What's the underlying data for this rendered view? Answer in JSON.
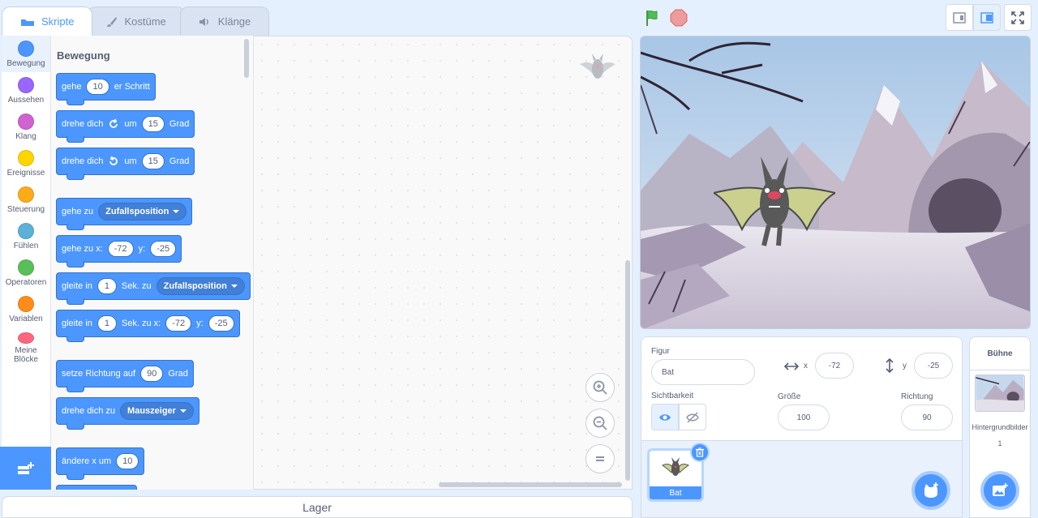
{
  "tabs": {
    "code": "Skripte",
    "costumes": "Kostüme",
    "sounds": "Klänge"
  },
  "categories": [
    {
      "label": "Bewegung",
      "color": "#4c97ff"
    },
    {
      "label": "Aussehen",
      "color": "#9966ff"
    },
    {
      "label": "Klang",
      "color": "#cf63cf"
    },
    {
      "label": "Ereignisse",
      "color": "#ffd500"
    },
    {
      "label": "Steuerung",
      "color": "#ffab19"
    },
    {
      "label": "Fühlen",
      "color": "#5cb1d6"
    },
    {
      "label": "Operatoren",
      "color": "#59c059"
    },
    {
      "label": "Variablen",
      "color": "#ff8c1a"
    },
    {
      "label": "Meine Blöcke",
      "color": "#ff6680"
    }
  ],
  "palette": {
    "title": "Bewegung",
    "blocks": {
      "move": {
        "t1": "gehe",
        "v1": "10",
        "t2": "er Schritt"
      },
      "turn_right": {
        "t1": "drehe dich",
        "t2": "um",
        "v1": "15",
        "t3": "Grad"
      },
      "turn_left": {
        "t1": "drehe dich",
        "t2": "um",
        "v1": "15",
        "t3": "Grad"
      },
      "goto": {
        "t1": "gehe zu",
        "d1": "Zufallsposition"
      },
      "goto_xy": {
        "t1": "gehe zu x:",
        "v1": "-72",
        "t2": "y:",
        "v2": "-25"
      },
      "glide": {
        "t1": "gleite in",
        "v1": "1",
        "t2": "Sek. zu",
        "d1": "Zufallsposition"
      },
      "glide_xy": {
        "t1": "gleite in",
        "v1": "1",
        "t2": "Sek. zu x:",
        "v2": "-72",
        "t3": "y:",
        "v3": "-25"
      },
      "point_dir": {
        "t1": "setze Richtung auf",
        "v1": "90",
        "t2": "Grad"
      },
      "point_towards": {
        "t1": "drehe dich zu",
        "d1": "Mauszeiger"
      },
      "change_x": {
        "t1": "ändere x um",
        "v1": "10"
      }
    }
  },
  "bottom_bar": "Lager",
  "sprite_info": {
    "figure_label": "Figur",
    "name": "Bat",
    "x_label": "x",
    "x": "-72",
    "y_label": "y",
    "y": "-25",
    "visibility_label": "Sichtbarkeit",
    "size_label": "Größe",
    "size": "100",
    "direction_label": "Richtung",
    "direction": "90"
  },
  "sprites": [
    {
      "name": "Bat"
    }
  ],
  "stage_pane": {
    "title": "Bühne",
    "backdrops_label": "Hintergrundbilder",
    "backdrops_count": "1"
  }
}
